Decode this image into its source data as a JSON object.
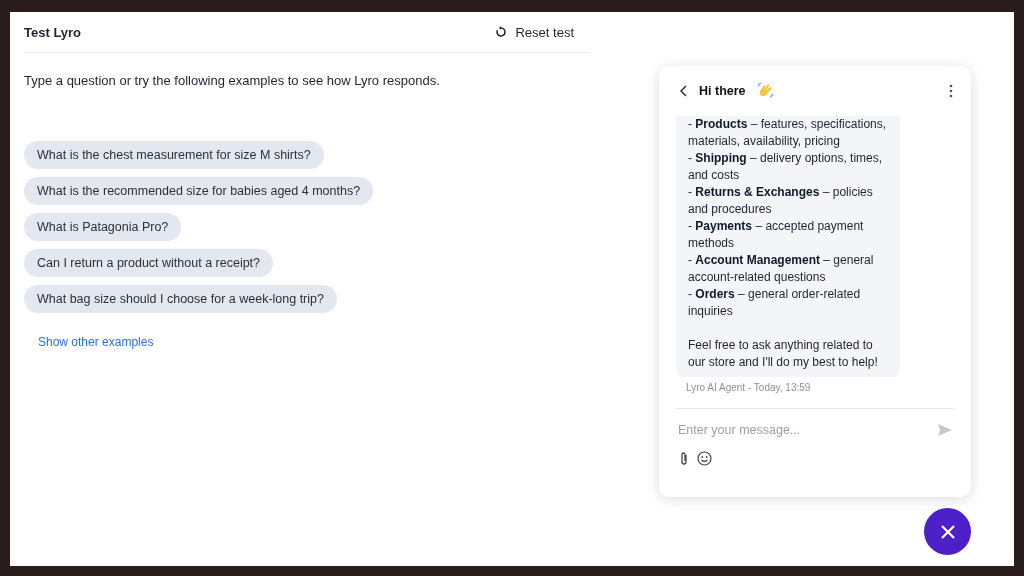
{
  "header": {
    "title": "Test Lyro",
    "reset_label": "Reset test"
  },
  "intro": "Type a question or try the following examples to see how Lyro responds.",
  "examples": [
    "What is the chest measurement for size M shirts?",
    "What is the recommended size for babies aged 4 months?",
    "What is Patagonia Pro?",
    "Can I return a product without a receipt?",
    "What bag size should I choose for a week-long trip?"
  ],
  "show_more_link": "Show other examples",
  "chat": {
    "title": "Hi there",
    "message_items": [
      "- **Products** – features, specifications, materials, availability, pricing",
      "- **Shipping** – delivery options, times, and costs",
      "- **Returns & Exchanges** – policies and procedures",
      "- **Payments** – accepted payment methods",
      "- **Account Management** – general account-related questions",
      "- **Orders** – general order-related inquiries"
    ],
    "message_closing": "Feel free to ask anything related to our store and I'll do my best to help!",
    "meta": "Lyro AI Agent - Today, 13:59",
    "input_placeholder": "Enter your message..."
  }
}
